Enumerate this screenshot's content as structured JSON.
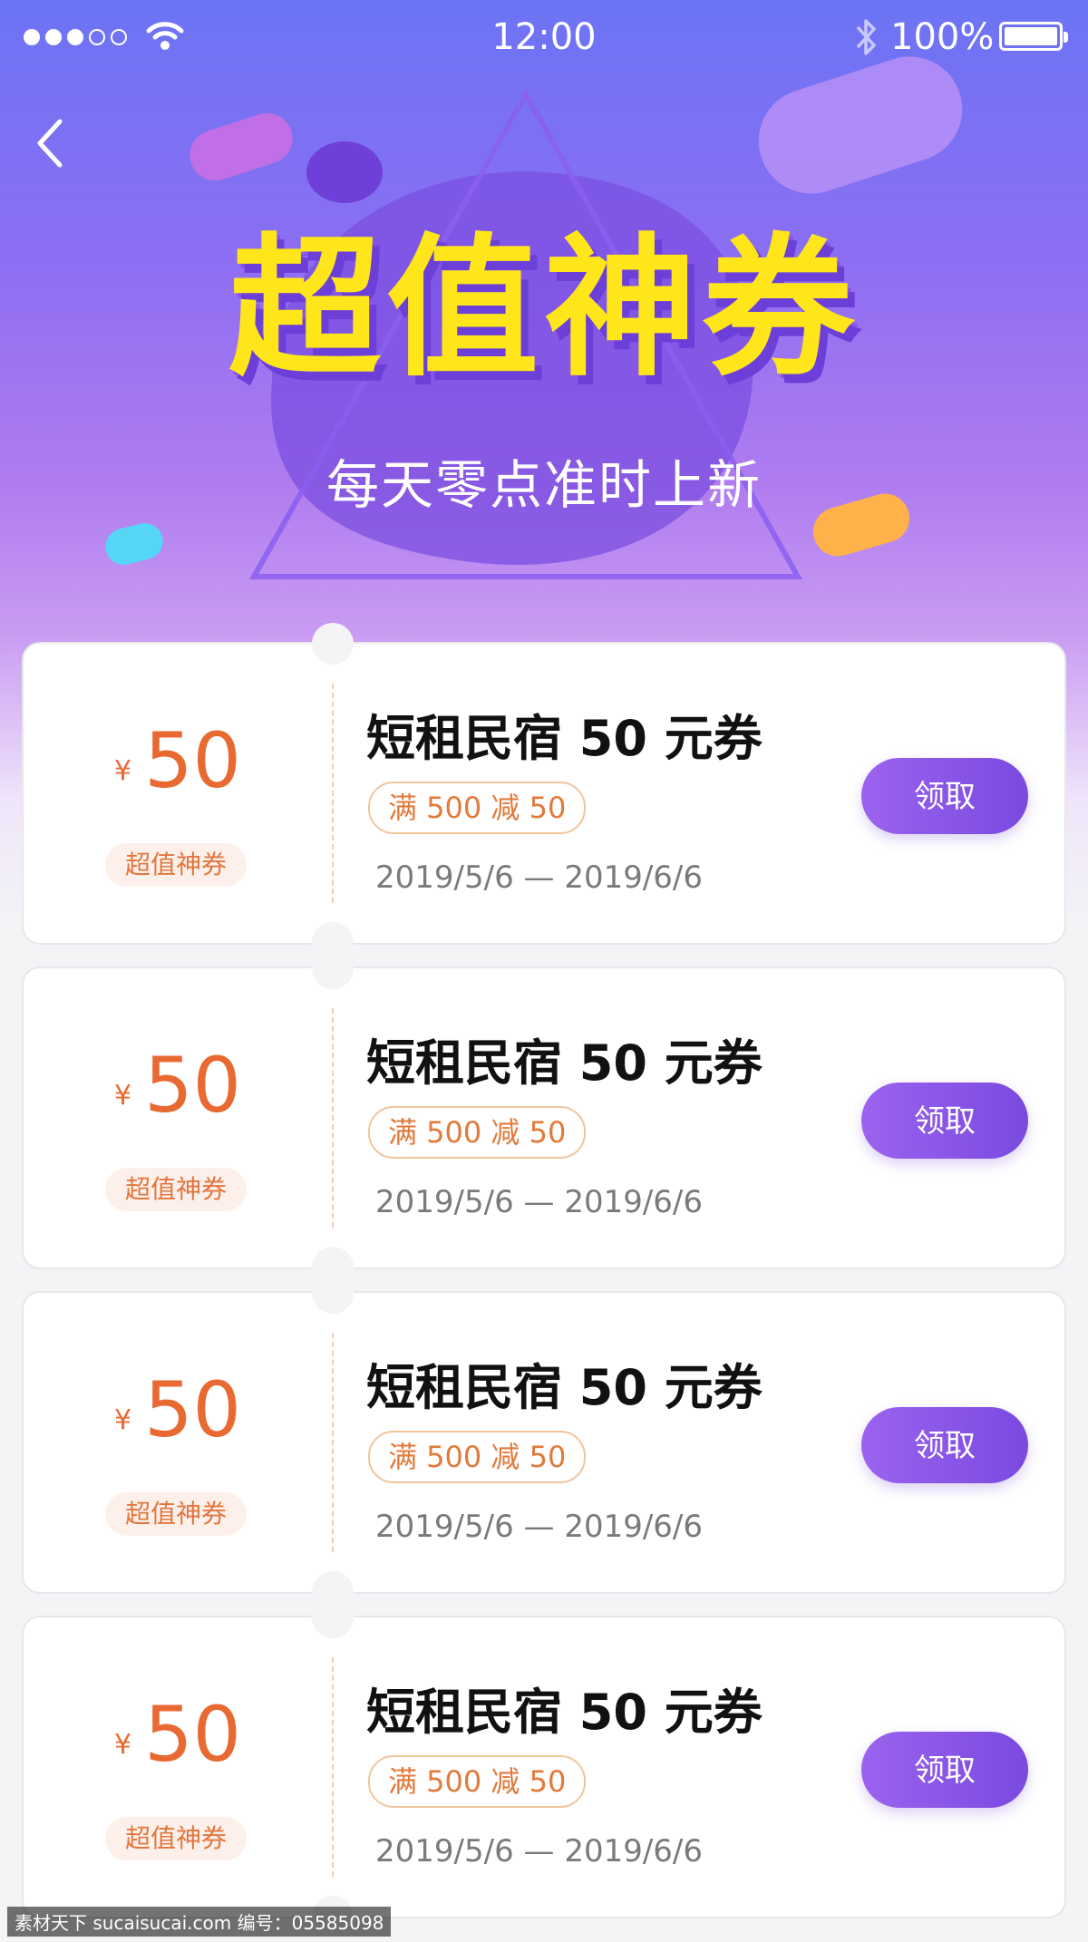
{
  "status_bar": {
    "time": "12:00",
    "battery_text": "100%",
    "signal_dots": 5,
    "signal_filled": 3
  },
  "header": {
    "title": "超值神券",
    "subtitle": "每天零点准时上新",
    "back_icon": "chevron-left-icon"
  },
  "colors": {
    "accent_purple": "#8a52e8",
    "title_yellow": "#ffe61a",
    "price_orange": "#e86a32"
  },
  "coupons": [
    {
      "currency": "¥",
      "amount": "50",
      "tag": "超值神券",
      "title": "短租民宿 50 元券",
      "rule": "满 500 减 50",
      "date_range": "2019/5/6 — 2019/6/6",
      "button": "领取"
    },
    {
      "currency": "¥",
      "amount": "50",
      "tag": "超值神券",
      "title": "短租民宿 50 元券",
      "rule": "满 500 减 50",
      "date_range": "2019/5/6 — 2019/6/6",
      "button": "领取"
    },
    {
      "currency": "¥",
      "amount": "50",
      "tag": "超值神券",
      "title": "短租民宿 50 元券",
      "rule": "满 500 减 50",
      "date_range": "2019/5/6 — 2019/6/6",
      "button": "领取"
    },
    {
      "currency": "¥",
      "amount": "50",
      "tag": "超值神券",
      "title": "短租民宿 50 元券",
      "rule": "满 500 减 50",
      "date_range": "2019/5/6 — 2019/6/6",
      "button": "领取"
    }
  ],
  "watermark": "素材天下 sucaisucai.com 编号：05585098"
}
